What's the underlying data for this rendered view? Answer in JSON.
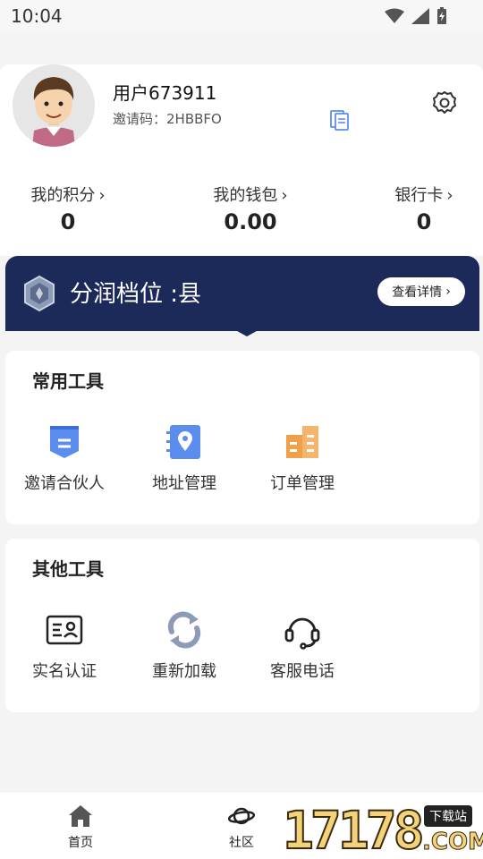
{
  "status": {
    "time": "10:04"
  },
  "profile": {
    "username": "用户673911",
    "invite_label": "邀请码：",
    "invite_code": "2HBBFO"
  },
  "stats": [
    {
      "label": "我的积分",
      "value": "0"
    },
    {
      "label": "我的钱包",
      "value": "0.00"
    },
    {
      "label": "银行卡",
      "value": "0"
    }
  ],
  "tier": {
    "text": "分润档位 :县",
    "button": "查看详情"
  },
  "common_tools": {
    "title": "常用工具",
    "items": [
      {
        "label": "邀请合伙人",
        "icon": "invite-partner-icon"
      },
      {
        "label": "地址管理",
        "icon": "address-book-icon"
      },
      {
        "label": "订单管理",
        "icon": "order-building-icon"
      }
    ]
  },
  "other_tools": {
    "title": "其他工具",
    "items": [
      {
        "label": "实名认证",
        "icon": "id-card-icon"
      },
      {
        "label": "重新加载",
        "icon": "reload-icon"
      },
      {
        "label": "客服电话",
        "icon": "headset-icon"
      }
    ]
  },
  "nav": [
    {
      "label": "首页",
      "icon": "home-icon"
    },
    {
      "label": "社区",
      "icon": "planet-icon"
    }
  ],
  "watermark": {
    "digits": "17178",
    "tag": "下载站",
    "domain": ".COM"
  },
  "colors": {
    "banner": "#1b2a59",
    "accent_blue": "#5b8def",
    "accent_orange": "#f0a04b"
  }
}
